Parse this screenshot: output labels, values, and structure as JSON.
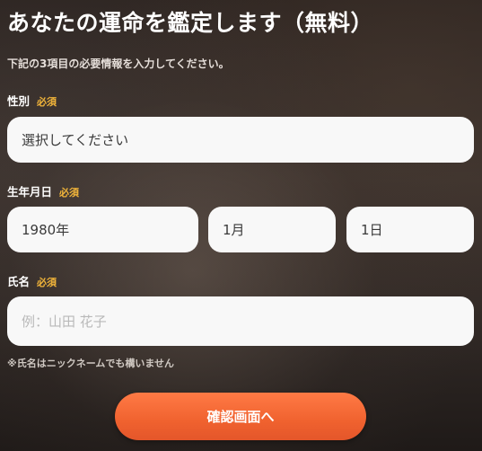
{
  "page": {
    "title": "あなたの運命を鑑定します（無料）",
    "intro": "下記の3項目の必要情報を入力してください。"
  },
  "form": {
    "required_badge": "必須",
    "gender": {
      "label": "性別",
      "value": "選択してください"
    },
    "birthdate": {
      "label": "生年月日",
      "year": "1980年",
      "month": "1月",
      "day": "1日"
    },
    "name": {
      "label": "氏名",
      "placeholder": "例：山田 花子",
      "note": "※氏名はニックネームでも構いません"
    },
    "submit_label": "確認画面へ"
  },
  "colors": {
    "required": "#f2b53a",
    "button": "#f0622f",
    "field_bg": "#f8f8f8"
  }
}
